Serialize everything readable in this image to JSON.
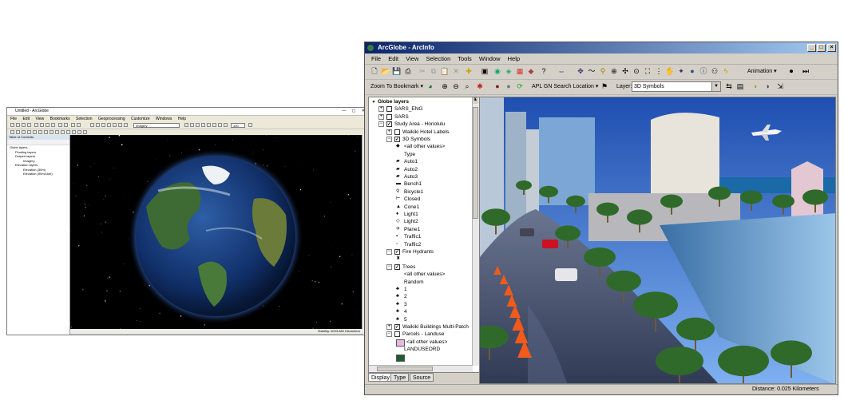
{
  "left_window": {
    "title": "Untitled - ArcGlobe",
    "menu": [
      "File",
      "Edit",
      "View",
      "Bookmarks",
      "Selection",
      "Geoprocessing",
      "Customize",
      "Windows",
      "Help"
    ],
    "layer_combo": "Imagery",
    "scale_combo": "100",
    "toc_title": "Table of Contents",
    "toc_items": [
      "Globe layers",
      "Floating layers",
      "Draped layers",
      "Imagery",
      "Elevation layers",
      "Elevation (30m)",
      "Elevation (90m/1km)"
    ],
    "status": "Visibility: 5023.882 Kilometers"
  },
  "right_window": {
    "title": "ArcGlobe - ArcInfo",
    "menu": [
      "File",
      "Edit",
      "View",
      "Selection",
      "Tools",
      "Window",
      "Help"
    ],
    "toolbar_animation": "Animation",
    "zoom_bookmark": "Zoom To Bookmark",
    "search_location": "APL GN Search Location",
    "layer_label": "Layer:",
    "layer_value": "3D Symbols",
    "toc": {
      "root": "Globe layers",
      "items": [
        {
          "label": "SARS_ENG",
          "level": 1,
          "expander": "+",
          "checked": false
        },
        {
          "label": "SARS",
          "level": 1,
          "expander": "+",
          "checked": false
        },
        {
          "label": "Study Area - Honolulu",
          "level": 1,
          "expander": "−",
          "checked": true
        },
        {
          "label": "Waikiki Hotel Labels",
          "level": 2,
          "expander": "+",
          "checked": false
        },
        {
          "label": "3D Symbols",
          "level": 2,
          "expander": "−",
          "checked": true
        },
        {
          "label": "<all other values>",
          "level": 3,
          "symbol": "◆"
        },
        {
          "label": "Type",
          "level": 4
        },
        {
          "label": "Auto1",
          "level": 3,
          "symbol": "▰"
        },
        {
          "label": "Auto2",
          "level": 3,
          "symbol": "▰"
        },
        {
          "label": "Auto3",
          "level": 3,
          "symbol": "▰"
        },
        {
          "label": "Bench1",
          "level": 3,
          "symbol": "▬"
        },
        {
          "label": "Bicycle1",
          "level": 3,
          "symbol": "⚲"
        },
        {
          "label": "Closed",
          "level": 3,
          "symbol": "⊢"
        },
        {
          "label": "Cone1",
          "level": 3,
          "symbol": "▲"
        },
        {
          "label": "Light1",
          "level": 3,
          "symbol": "♦"
        },
        {
          "label": "Light2",
          "level": 3,
          "symbol": "◇"
        },
        {
          "label": "Plane1",
          "level": 3,
          "symbol": "✈"
        },
        {
          "label": "Traffic1",
          "level": 3,
          "symbol": "▪"
        },
        {
          "label": "Traffic2",
          "level": 3,
          "symbol": "▫"
        },
        {
          "label": "Fire Hydrants",
          "level": 2,
          "expander": "−",
          "checked": true
        },
        {
          "label": "",
          "level": 3,
          "symbol": "♜"
        },
        {
          "label": "Trees",
          "level": 2,
          "expander": "−",
          "checked": true
        },
        {
          "label": "<all other values>",
          "level": 3,
          "symbol": ""
        },
        {
          "label": "Random",
          "level": 4
        },
        {
          "label": "1",
          "level": 3,
          "symbol": "♣"
        },
        {
          "label": "2",
          "level": 3,
          "symbol": "♣"
        },
        {
          "label": "3",
          "level": 3,
          "symbol": "♣"
        },
        {
          "label": "4",
          "level": 3,
          "symbol": "♣"
        },
        {
          "label": "5",
          "level": 3,
          "symbol": "♣"
        },
        {
          "label": "Waikiki Buildings Multi-Patch",
          "level": 2,
          "expander": "+",
          "checked": true
        },
        {
          "label": "Parcels - Landuse",
          "level": 2,
          "expander": "−",
          "checked": false
        },
        {
          "label": "<all other values>",
          "level": 3,
          "swatch": "#e8b8e0"
        },
        {
          "label": "LANDUSEORD",
          "level": 4
        },
        {
          "label": "",
          "level": 3,
          "swatch": "#1f5a32"
        }
      ]
    },
    "tabs": [
      "Display",
      "Type",
      "Source"
    ],
    "status_distance": "Distance: 0.025 Kilometers"
  }
}
